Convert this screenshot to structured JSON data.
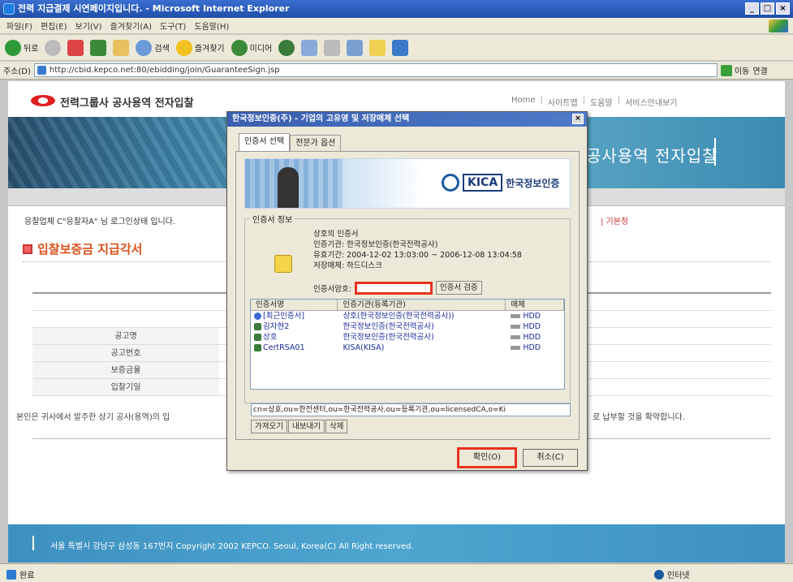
{
  "window": {
    "title": "전력 지급결제 시연페이지입니다. - Microsoft Internet Explorer",
    "controls": [
      "_",
      "□",
      "×"
    ]
  },
  "menu": [
    "파일(F)",
    "편집(E)",
    "보기(V)",
    "즐겨찾기(A)",
    "도구(T)",
    "도움말(H)"
  ],
  "toolbar": {
    "back": "뒤로",
    "search": "검색",
    "favorites": "즐겨찾기",
    "media": "미디어"
  },
  "address": {
    "label": "주소(D)",
    "url": "http://cbid.kepco.net:80/ebidding/join/GuaranteeSign.jsp",
    "go": "이동",
    "links": "연결"
  },
  "page": {
    "site_title": "전력그룹사 공사용역 전자입찰",
    "top_links": [
      "Home",
      "사이트맵",
      "도움말",
      "서비스안내보기"
    ],
    "banner_title": "공사용역 전자입찰",
    "welcome": "응찰업체 C\"응찰자A\" 님 로그인상태 입니다.",
    "crumb_right": "| 기본정",
    "section_title": "입찰보증금 지급각서",
    "form_labels": [
      "공고명",
      "공고번호",
      "보증금율",
      "입찰기일"
    ],
    "notice_left": "본인은 귀사에서 발주한 상기 공사(용역)의 입",
    "notice_right": "로 납부할 것을 확약합니다.",
    "footer": "서울 특별시 강남구 삼성동 167번지 Copyright 2002 KEPCO. Seoul, Korea(C) All Right reserved."
  },
  "dialog": {
    "title": "한국정보인증(주) - 기업의 고유영 및 저장매체 선택",
    "tabs": [
      "인증서 선택",
      "전문가 옵션"
    ],
    "kica_logo": "KICA",
    "kica_name": "한국정보인증",
    "info_legend": "인증서 정보",
    "cert_holder": "상호의 인증서",
    "issuer": "인증기관:  한국정보인증(한국전력공사)",
    "validity": "유효기간:  2004-12-02 13:03:00 ~ 2006-12-08 13:04:58",
    "storage": "저장매체:  하드디스크",
    "password_label": "인증서암호:",
    "password_value": "",
    "verify_button": "인증서 검증",
    "columns": [
      "인증서명",
      "인증기관(등록기관)",
      "매체"
    ],
    "rows": [
      {
        "name": "[최근인증서]",
        "issuer": "상호(한국정보인증(한국전력공사))",
        "media": "HDD"
      },
      {
        "name": "김자현2",
        "issuer": "한국정보인증(한국전력공사)",
        "media": "HDD"
      },
      {
        "name": "상호",
        "issuer": "한국정보인증(한국전력공사)",
        "media": "HDD"
      },
      {
        "name": "CertRSA01",
        "issuer": "KISA(KISA)",
        "media": "HDD"
      }
    ],
    "dn": "cn=상호,ou=한전센터,ou=한국전력공사,ou=등록기관,ou=licensedCA,o=Ki",
    "buttons": [
      "가져오기",
      "내보내기",
      "삭제"
    ],
    "ok": "확인(O)",
    "cancel": "취소(C)"
  },
  "status": {
    "left": "완료",
    "right": "인터넷"
  }
}
